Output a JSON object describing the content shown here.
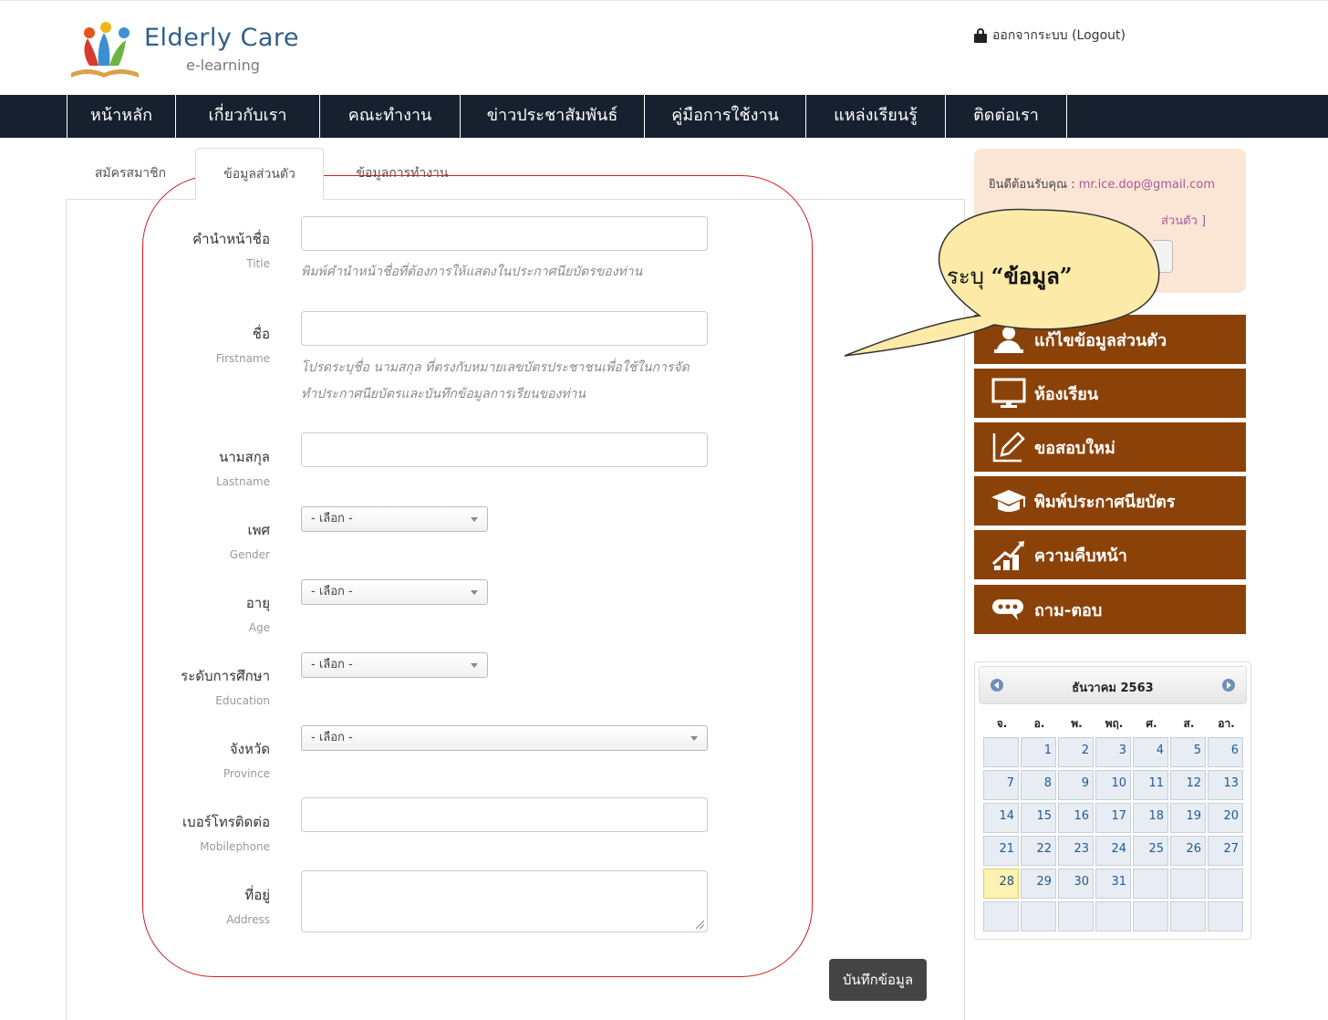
{
  "header": {
    "logo_title": "Elderly Care",
    "logo_subtitle": "e-learning",
    "logout_label": "ออกจากระบบ (Logout)"
  },
  "nav": {
    "items": [
      "หน้าหลัก",
      "เกี่ยวกับเรา",
      "คณะทำงาน",
      "ข่าวประชาสัมพันธ์",
      "คู่มือการใช้งาน",
      "แหล่งเรียนรู้",
      "ติดต่อเรา"
    ]
  },
  "tabs": {
    "items": [
      "สมัครสมาชิก",
      "ข้อมูลส่วนตัว",
      "ข้อมูลการทำงาน"
    ],
    "active": "ข้อมูลส่วนตัว"
  },
  "form": {
    "title": {
      "label": "คำนำหน้าชื่อ",
      "label_en": "Title",
      "value": "",
      "help": "พิมพ์คำนำหน้าชื่อที่ต้องการให้แสดงในประกาศนียบัตรของท่าน"
    },
    "firstname": {
      "label": "ชื่อ",
      "label_en": "Firstname",
      "value": "",
      "help_line1": "โปรดระบุชื่อ นามสกุล ที่ตรงกับหมายเลขบัตรประชาชนเพื่อใช้ในการจัด",
      "help_line2": "ทำประกาศนียบัตรและบันทึกข้อมูลการเรียนของท่าน"
    },
    "lastname": {
      "label": "นามสกุล",
      "label_en": "Lastname",
      "value": ""
    },
    "gender": {
      "label": "เพศ",
      "label_en": "Gender",
      "selected": "- เลือก -"
    },
    "age": {
      "label": "อายุ",
      "label_en": "Age",
      "selected": "- เลือก -"
    },
    "education": {
      "label": "ระดับการศึกษา",
      "label_en": "Education",
      "selected": "- เลือก -"
    },
    "province": {
      "label": "จังหวัด",
      "label_en": "Province",
      "selected": "- เลือก -"
    },
    "mobilephone": {
      "label": "เบอร์โทรติดต่อ",
      "label_en": "Mobilephone",
      "value": ""
    },
    "address": {
      "label": "ที่อยู่",
      "label_en": "Address",
      "value": ""
    },
    "save_label": "บันทึกข้อมูล"
  },
  "sidebar": {
    "welcome_prefix": "ยินดีต้อนรับคุณ : ",
    "welcome_email": "mr.ice.dop@gmail.com",
    "welcome_link": "ส่วนตัว ]",
    "menu": [
      {
        "label": "แก้ไขข้อมูลส่วนตัว",
        "icon": "user-edit-icon"
      },
      {
        "label": "ห้องเรียน",
        "icon": "monitor-icon"
      },
      {
        "label": "ขอสอบใหม่",
        "icon": "pencil-icon"
      },
      {
        "label": "พิมพ์ประกาศนียบัตร",
        "icon": "graduation-cap-icon"
      },
      {
        "label": "ความคืบหน้า",
        "icon": "progress-chart-icon"
      },
      {
        "label": "ถาม-ตอบ",
        "icon": "chat-icon"
      }
    ],
    "menu_color": "#8b4209"
  },
  "calendar": {
    "title": "ธันวาคม 2563",
    "days_of_week": [
      "จ.",
      "อ.",
      "พ.",
      "พฤ.",
      "ศ.",
      "ส.",
      "อา."
    ],
    "weeks": [
      [
        "",
        "1",
        "2",
        "3",
        "4",
        "5",
        "6"
      ],
      [
        "7",
        "8",
        "9",
        "10",
        "11",
        "12",
        "13"
      ],
      [
        "14",
        "15",
        "16",
        "17",
        "18",
        "19",
        "20"
      ],
      [
        "21",
        "22",
        "23",
        "24",
        "25",
        "26",
        "27"
      ],
      [
        "28",
        "29",
        "30",
        "31",
        "",
        "",
        ""
      ],
      [
        "",
        "",
        "",
        "",
        "",
        "",
        ""
      ]
    ],
    "today": "28"
  },
  "annotation": {
    "callout_prefix": "ระบุ ",
    "callout_bold": "“ข้อมูล”",
    "highlight_color": "#d71920"
  }
}
